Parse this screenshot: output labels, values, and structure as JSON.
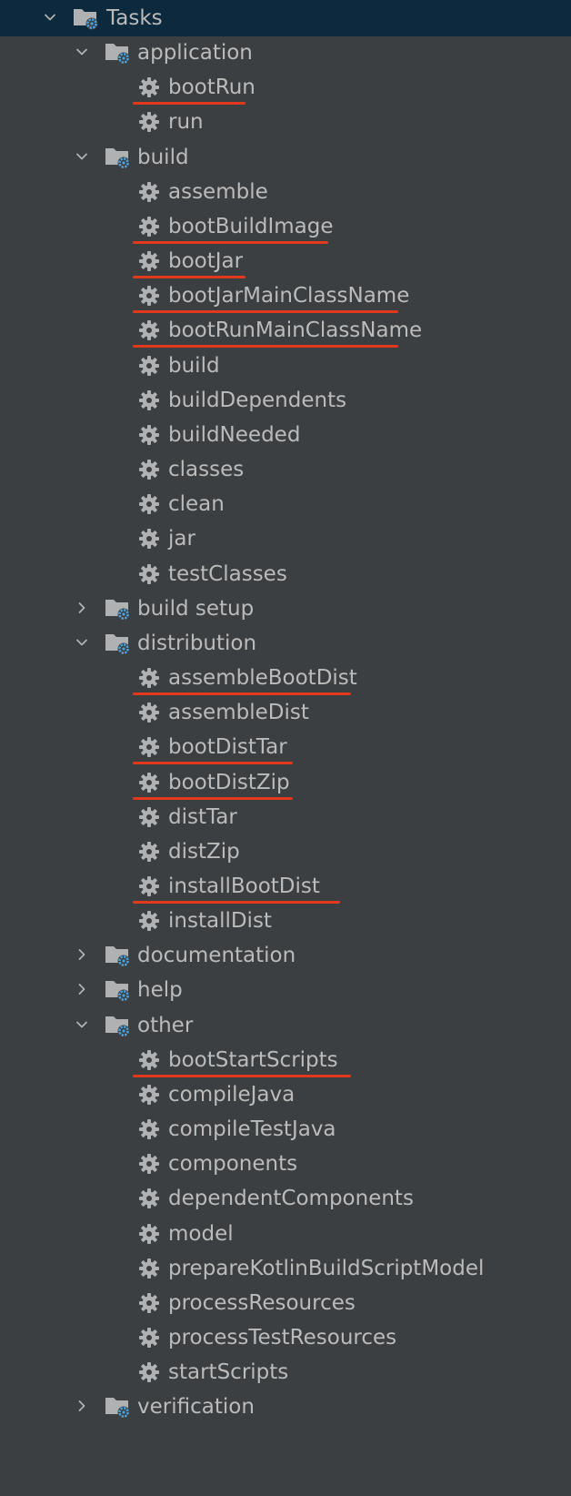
{
  "colors": {
    "background": "#3c3f41",
    "selected_row": "#0d293e",
    "text": "#bbbbbb",
    "icon": "#afb1b3",
    "gear_badge": "#4a9fd8",
    "annotation_underline": "#e0391e"
  },
  "tree": {
    "root": {
      "label": "Tasks",
      "expanded": true,
      "selected": true,
      "icon": "task-folder-icon"
    },
    "groups": [
      {
        "label": "application",
        "expanded": true,
        "icon": "task-folder-icon",
        "tasks": [
          {
            "label": "bootRun",
            "highlighted": true
          },
          {
            "label": "run",
            "highlighted": false
          }
        ]
      },
      {
        "label": "build",
        "expanded": true,
        "icon": "task-folder-icon",
        "tasks": [
          {
            "label": "assemble",
            "highlighted": false
          },
          {
            "label": "bootBuildImage",
            "highlighted": true
          },
          {
            "label": "bootJar",
            "highlighted": true
          },
          {
            "label": "bootJarMainClassName",
            "highlighted": true
          },
          {
            "label": "bootRunMainClassName",
            "highlighted": true
          },
          {
            "label": "build",
            "highlighted": false
          },
          {
            "label": "buildDependents",
            "highlighted": false
          },
          {
            "label": "buildNeeded",
            "highlighted": false
          },
          {
            "label": "classes",
            "highlighted": false
          },
          {
            "label": "clean",
            "highlighted": false
          },
          {
            "label": "jar",
            "highlighted": false
          },
          {
            "label": "testClasses",
            "highlighted": false
          }
        ]
      },
      {
        "label": "build setup",
        "expanded": false,
        "icon": "task-folder-icon",
        "tasks": []
      },
      {
        "label": "distribution",
        "expanded": true,
        "icon": "task-folder-icon",
        "tasks": [
          {
            "label": "assembleBootDist",
            "highlighted": true
          },
          {
            "label": "assembleDist",
            "highlighted": false
          },
          {
            "label": "bootDistTar",
            "highlighted": true
          },
          {
            "label": "bootDistZip",
            "highlighted": true
          },
          {
            "label": "distTar",
            "highlighted": false
          },
          {
            "label": "distZip",
            "highlighted": false
          },
          {
            "label": "installBootDist",
            "highlighted": true
          },
          {
            "label": "installDist",
            "highlighted": false
          }
        ]
      },
      {
        "label": "documentation",
        "expanded": false,
        "icon": "task-folder-icon",
        "tasks": []
      },
      {
        "label": "help",
        "expanded": false,
        "icon": "task-folder-icon",
        "tasks": []
      },
      {
        "label": "other",
        "expanded": true,
        "icon": "task-folder-icon",
        "tasks": [
          {
            "label": "bootStartScripts",
            "highlighted": true
          },
          {
            "label": "compileJava",
            "highlighted": false
          },
          {
            "label": "compileTestJava",
            "highlighted": false
          },
          {
            "label": "components",
            "highlighted": false
          },
          {
            "label": "dependentComponents",
            "highlighted": false
          },
          {
            "label": "model",
            "highlighted": false
          },
          {
            "label": "prepareKotlinBuildScriptModel",
            "highlighted": false
          },
          {
            "label": "processResources",
            "highlighted": false
          },
          {
            "label": "processTestResources",
            "highlighted": false
          },
          {
            "label": "startScripts",
            "highlighted": false
          }
        ]
      },
      {
        "label": "verification",
        "expanded": false,
        "icon": "task-folder-icon",
        "tasks": []
      }
    ]
  }
}
